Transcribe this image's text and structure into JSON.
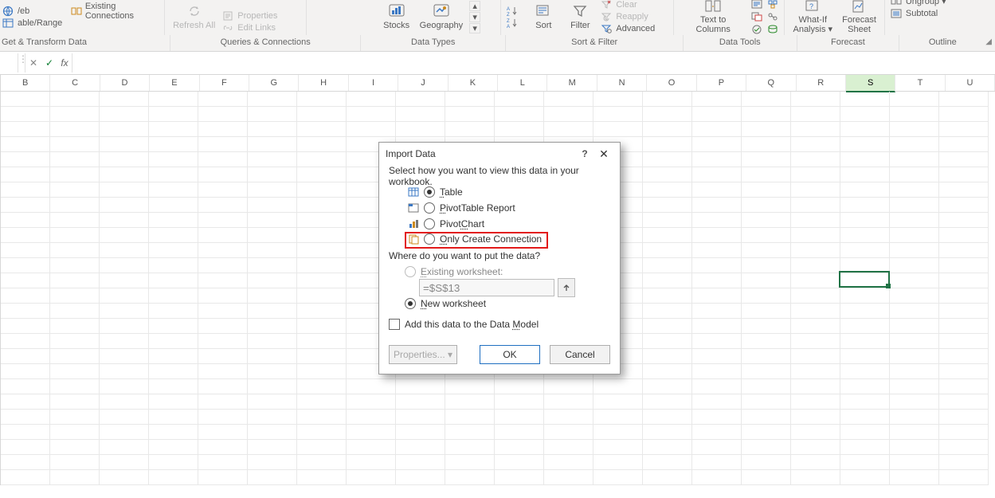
{
  "ribbon": {
    "groups": {
      "get_transform": {
        "label": "Get & Transform Data",
        "existing_conn": "Existing Connections",
        "table_range": "able/Range",
        "web": "/eb"
      },
      "queries_conn": {
        "label": "Queries & Connections",
        "refresh": "Refresh All",
        "dd": "▾",
        "properties": "Properties",
        "edit_links": "Edit Links"
      },
      "data_types": {
        "label": "Data Types",
        "stocks": "Stocks",
        "geography": "Geography",
        "dd": "▾"
      },
      "sort_filter": {
        "label": "Sort & Filter",
        "sort": "Sort",
        "az": "A↓Z",
        "za": "Z↓A",
        "filter": "Filter",
        "clear": "Clear",
        "reapply": "Reapply",
        "advanced": "Advanced"
      },
      "data_tools": {
        "label": "Data Tools",
        "text_to_columns": "Text to Columns"
      },
      "forecast": {
        "label": "Forecast",
        "whatif": "What-If Analysis",
        "dd": "▾",
        "sheet": "Forecast Sheet"
      },
      "outline": {
        "label": "Outline",
        "ungroup": "Ungroup",
        "dd": "▾",
        "subtotal": "Subtotal"
      }
    }
  },
  "fx": {
    "fx": "fx",
    "cancel": "✕",
    "enter": "✓",
    "value": ""
  },
  "columns": [
    "B",
    "C",
    "D",
    "E",
    "F",
    "G",
    "H",
    "I",
    "J",
    "K",
    "L",
    "M",
    "N",
    "O",
    "P",
    "Q",
    "R",
    "S",
    "T",
    "U"
  ],
  "selected_col": "S",
  "dialog": {
    "title": "Import Data",
    "prompt": "Select how you want to view this data in your workbook.",
    "opts": {
      "table": "Table",
      "pivot_report": "PivotTable Report",
      "pivot_chart": "PivotChart",
      "only_conn": "Only Create Connection"
    },
    "put_prompt": "Where do you want to put the data?",
    "existing_ws": "Existing worksheet:",
    "ref_value": "=$S$13",
    "new_ws": "New worksheet",
    "add_model": "Add this data to the Data Model",
    "properties": "Properties...",
    "ok": "OK",
    "cancel": "Cancel",
    "help": "?",
    "close": "✕"
  }
}
